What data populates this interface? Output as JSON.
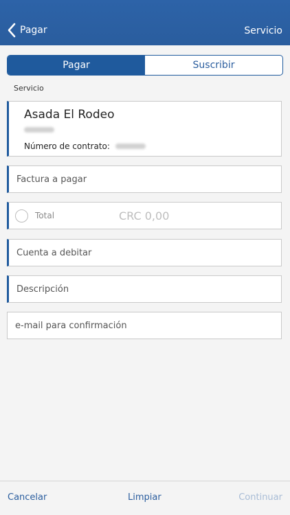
{
  "header": {
    "back_label": "Pagar",
    "right_title": "Servicio",
    "color": "#2d63a8"
  },
  "tabs": [
    {
      "label": "Pagar",
      "active": true
    },
    {
      "label": "Suscribir",
      "active": false
    }
  ],
  "section_label": "Servicio",
  "service": {
    "name": "Asada El Rodeo",
    "contract_label": "Número de contrato:"
  },
  "fields": {
    "factura_placeholder": "Factura a pagar",
    "total_label": "Total",
    "total_amount": "CRC 0,00",
    "cuenta_placeholder": "Cuenta a debitar",
    "descripcion_placeholder": "Descripción",
    "email_placeholder": "e-mail para confirmación"
  },
  "footer": {
    "cancel": "Cancelar",
    "clear": "Limpiar",
    "continue": "Continuar"
  },
  "icons": {
    "back": "chevron-left-icon"
  }
}
